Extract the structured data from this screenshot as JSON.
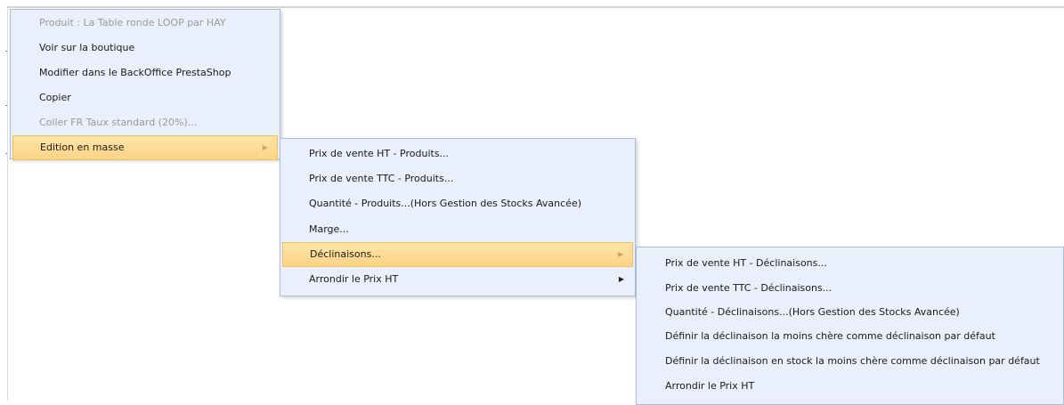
{
  "context_menu": {
    "items": [
      {
        "label": "Produit : La Table ronde LOOP par HAY",
        "disabled": true
      },
      {
        "label": "Voir sur la boutique"
      },
      {
        "label": "Modifier dans le BackOffice PrestaShop"
      },
      {
        "label": "Copier"
      },
      {
        "label": "Coller FR Taux standard (20%)...",
        "disabled": true
      },
      {
        "label": "Edition en masse",
        "active": true,
        "submenu_arrow": "chevron-right-icon"
      }
    ]
  },
  "mass_edit_submenu": {
    "items": [
      {
        "label": "Prix de vente HT - Produits..."
      },
      {
        "label": "Prix de vente TTC - Produits..."
      },
      {
        "label": "Quantité - Produits...(Hors Gestion des Stocks Avancée)"
      },
      {
        "label": "Marge..."
      },
      {
        "label": "Déclinaisons...",
        "active": true,
        "submenu_arrow": "chevron-right-icon"
      },
      {
        "label": "Arrondir le Prix HT",
        "submenu_arrow": "chevron-right-icon"
      }
    ]
  },
  "variations_submenu": {
    "items": [
      {
        "label": "Prix de vente HT - Déclinaisons..."
      },
      {
        "label": "Prix de vente TTC - Déclinaisons..."
      },
      {
        "label": "Quantité - Déclinaisons...(Hors Gestion des Stocks Avancée)"
      },
      {
        "label": "Définir la déclinaison la moins chère comme déclinaison par défaut"
      },
      {
        "label": "Définir la déclinaison en stock la moins chère comme déclinaison par défaut"
      },
      {
        "label": "Arrondir le Prix HT"
      }
    ]
  },
  "glyphs": {
    "submenu_arrow": "▶"
  },
  "colors": {
    "menu_background": "#e9f0fb",
    "menu_border": "#a9bedf",
    "highlight": "#fbd485",
    "disabled_text": "#9a9a9a"
  }
}
